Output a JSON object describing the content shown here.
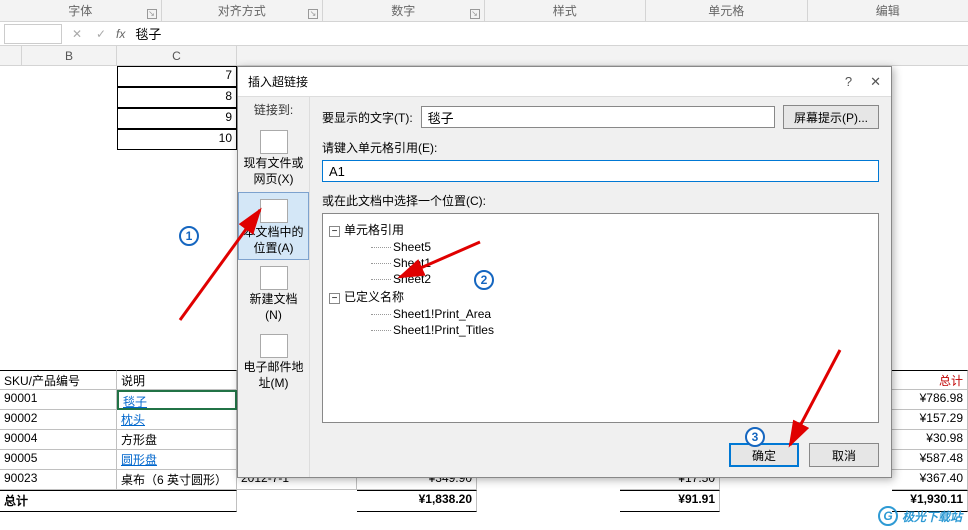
{
  "ribbon": {
    "groups": [
      "字体",
      "对齐方式",
      "数字",
      "样式",
      "单元格",
      "编辑"
    ]
  },
  "fxbar": {
    "name": "",
    "value": "毯子"
  },
  "colhdr": {
    "b": "B",
    "c": "C"
  },
  "topcells": {
    "c3": "7",
    "c4": "8",
    "c5": "9",
    "c6": "10"
  },
  "tbl": {
    "h_sku": "SKU/产品编号",
    "h_desc": "说明",
    "h_total": "总计",
    "rows": [
      {
        "sku": "90001",
        "desc": "毯子",
        "total": "¥786.98"
      },
      {
        "sku": "90002",
        "desc": "枕头",
        "total": "¥157.29"
      },
      {
        "sku": "90004",
        "desc": "方形盘",
        "total": "¥30.98"
      },
      {
        "sku": "90005",
        "desc": "圆形盘",
        "total": "¥587.48"
      },
      {
        "sku": "90023",
        "desc": "桌布（6 英寸圆形）",
        "date": "2012-7-1",
        "p1": "¥349.90",
        "p2": "¥17.50",
        "total": "¥367.40"
      }
    ],
    "foot": {
      "label": "总计",
      "v1": "¥1,838.20",
      "v2": "¥91.91",
      "v3": "¥1,930.11"
    }
  },
  "dialog": {
    "title": "插入超链接",
    "help": "?",
    "close": "✕",
    "linkto": "链接到:",
    "opt_file": "现有文件或网页(X)",
    "opt_doc": "本文档中的位置(A)",
    "opt_new": "新建文档(N)",
    "opt_mail": "电子邮件地址(M)",
    "disp_label": "要显示的文字(T):",
    "disp_value": "毯子",
    "tip_btn": "屏幕提示(P)...",
    "ref_label": "请键入单元格引用(E):",
    "ref_value": "A1",
    "loc_label": "或在此文档中选择一个位置(C):",
    "tree": {
      "cellrefs": "单元格引用",
      "s5": "Sheet5",
      "s1": "Sheet1",
      "s2": "Sheet2",
      "defs": "已定义名称",
      "pa": "Sheet1!Print_Area",
      "pt": "Sheet1!Print_Titles"
    },
    "ok": "确定",
    "cancel": "取消"
  },
  "watermark": {
    "text": "极光下载站",
    "g": "G"
  }
}
